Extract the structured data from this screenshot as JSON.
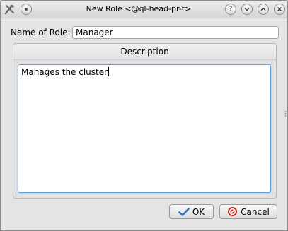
{
  "window": {
    "title": "New Role <@ql-head-pr-t>"
  },
  "titlebar_buttons": {
    "help": "?",
    "minimize": "⌄",
    "maximize": "⌃",
    "close": "✕"
  },
  "form": {
    "name_label": "Name of Role:",
    "name_value": "Manager",
    "description_header": "Description",
    "description_value": "Manages the cluster"
  },
  "buttons": {
    "ok": "OK",
    "cancel": "Cancel"
  },
  "colors": {
    "focus_border": "#5f9ed8",
    "ok_check": "#3a6fb0",
    "cancel_icon": "#c0281e"
  }
}
